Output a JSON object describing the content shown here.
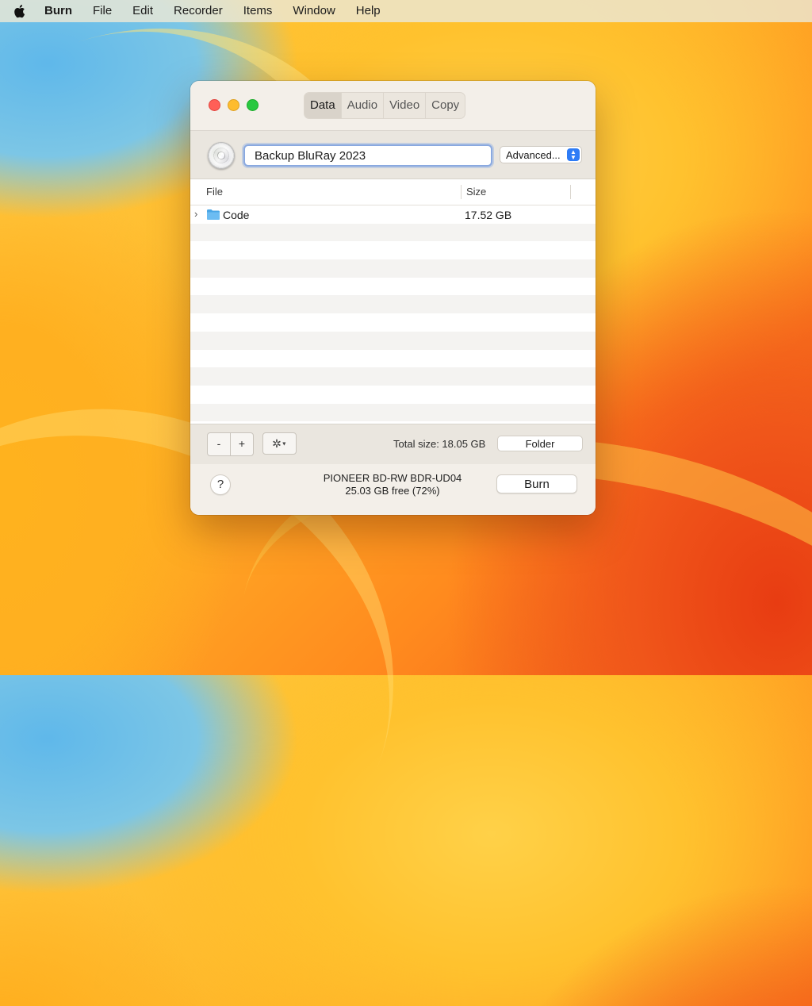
{
  "menubar": {
    "app_name": "Burn",
    "items": [
      "File",
      "Edit",
      "Recorder",
      "Items",
      "Window",
      "Help"
    ]
  },
  "window": {
    "tabs": [
      {
        "label": "Data",
        "active": true
      },
      {
        "label": "Audio",
        "active": false
      },
      {
        "label": "Video",
        "active": false
      },
      {
        "label": "Copy",
        "active": false
      }
    ],
    "disc_name": "Backup BluRay 2023",
    "advanced_label": "Advanced...",
    "table": {
      "columns": [
        "File",
        "Size"
      ],
      "rows": [
        {
          "name": "Code",
          "size": "17.52 GB",
          "icon": "folder-icon"
        }
      ]
    },
    "toolbar": {
      "remove_label": "-",
      "add_label": "+",
      "total_size": "Total size: 18.05 GB",
      "folder_label": "Folder"
    },
    "footer": {
      "help_label": "?",
      "drive_name": "PIONEER BD-RW BDR-UD04",
      "drive_free": "25.03 GB free (72%)",
      "burn_label": "Burn"
    }
  },
  "colors": {
    "accent": "#2e7cf6",
    "close": "#ff5f57",
    "minimize": "#febc2e",
    "zoom": "#28c840"
  }
}
